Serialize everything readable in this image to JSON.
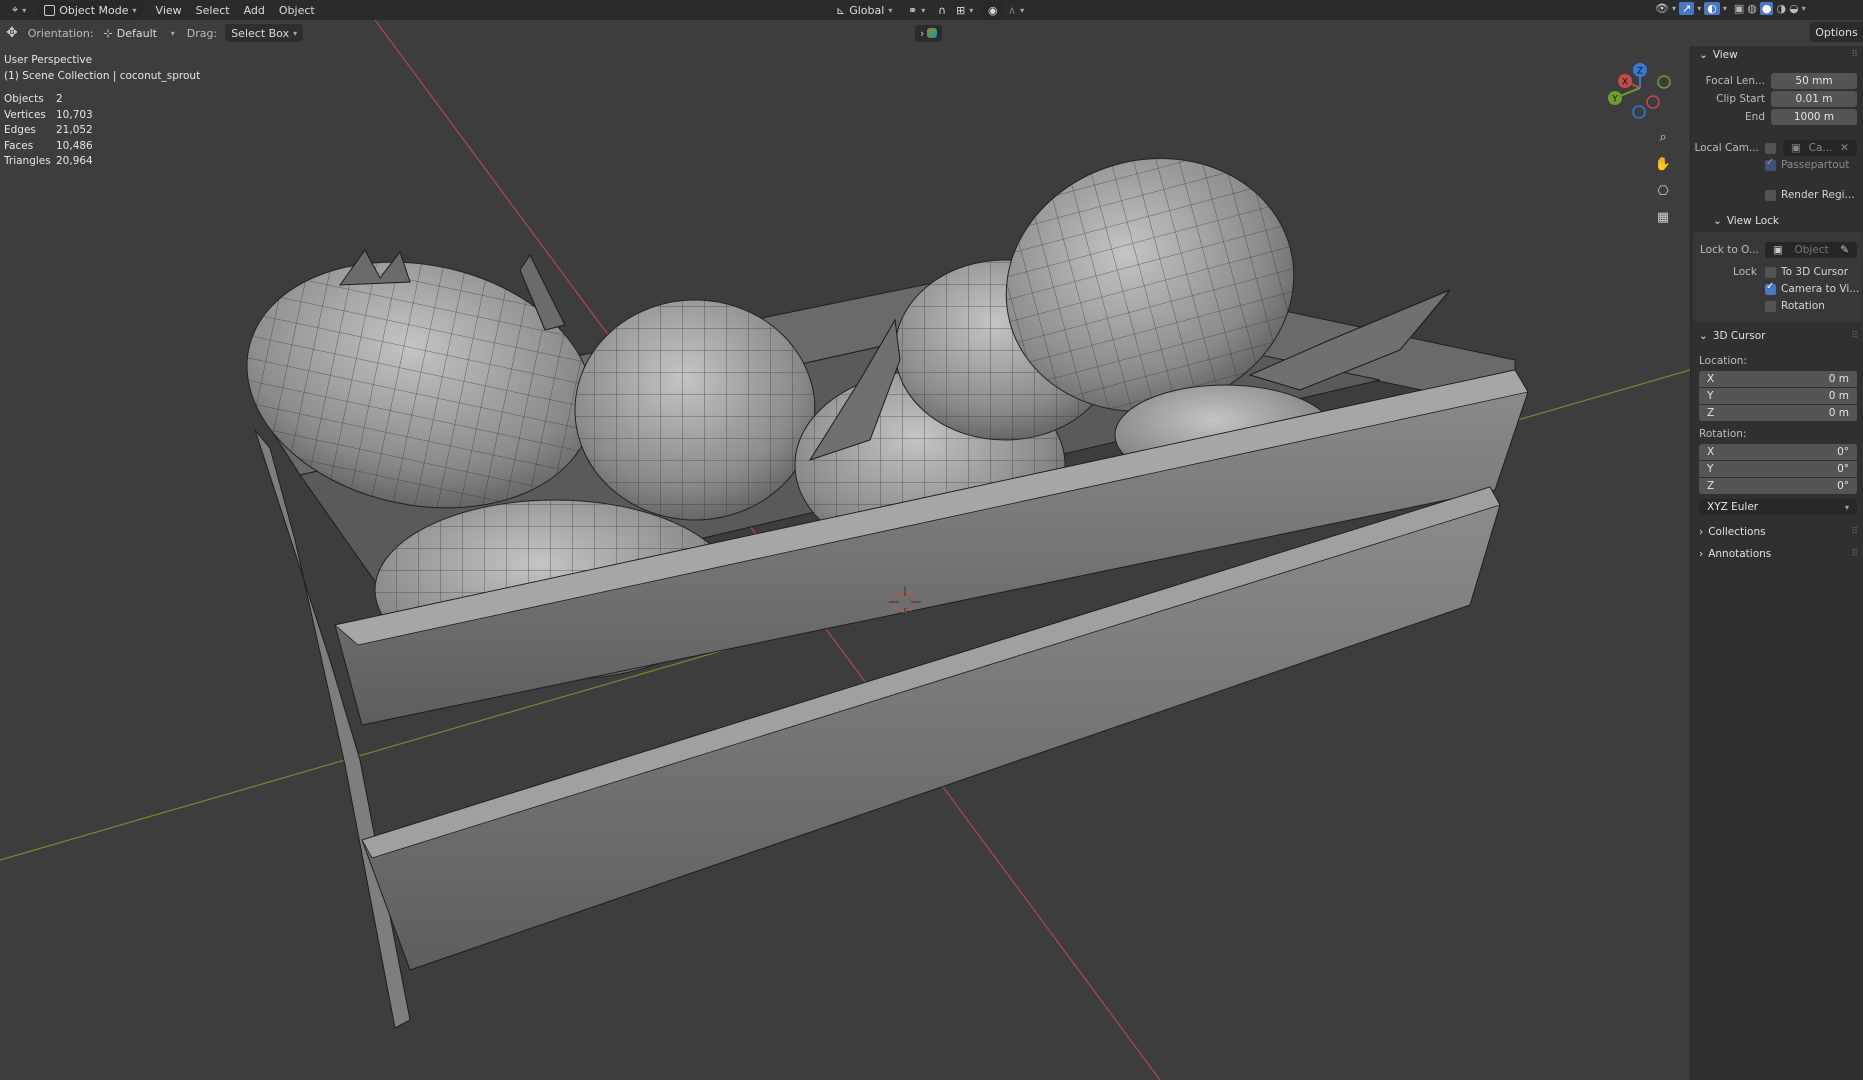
{
  "header": {
    "mode": "Object Mode",
    "menus": [
      "View",
      "Select",
      "Add",
      "Object"
    ],
    "transform_orientation": "Global"
  },
  "tool_settings": {
    "orientation_label": "Orientation:",
    "orientation_value": "Default",
    "drag_label": "Drag:",
    "drag_value": "Select Box",
    "options_label": "Options"
  },
  "viewport": {
    "perspective": "User Perspective",
    "collection": "(1) Scene Collection | coconut_sprout",
    "stats": [
      {
        "label": "Objects",
        "value": "2"
      },
      {
        "label": "Vertices",
        "value": "10,703"
      },
      {
        "label": "Edges",
        "value": "21,052"
      },
      {
        "label": "Faces",
        "value": "10,486"
      },
      {
        "label": "Triangles",
        "value": "20,964"
      }
    ],
    "gizmo_axes": [
      "X",
      "Y",
      "Z"
    ]
  },
  "npanel": {
    "view": {
      "title": "View",
      "focal_label": "Focal Len...",
      "focal_value": "50 mm",
      "clip_start_label": "Clip Start",
      "clip_start_value": "0.01 m",
      "end_label": "End",
      "end_value": "1000 m",
      "local_cam_label": "Local Cam...",
      "local_cam_value": "Ca...",
      "passepartout": "Passepartout",
      "render_region": "Render Regi..."
    },
    "view_lock": {
      "title": "View Lock",
      "lock_to_label": "Lock to O...",
      "lock_to_placeholder": "Object",
      "lock_label": "Lock",
      "to_3d_cursor": "To 3D Cursor",
      "camera_to_view": "Camera to Vi...",
      "rotation": "Rotation"
    },
    "cursor": {
      "title": "3D Cursor",
      "location_label": "Location:",
      "location": [
        {
          "axis": "X",
          "value": "0 m"
        },
        {
          "axis": "Y",
          "value": "0 m"
        },
        {
          "axis": "Z",
          "value": "0 m"
        }
      ],
      "rotation_label": "Rotation:",
      "rotation": [
        {
          "axis": "X",
          "value": "0°"
        },
        {
          "axis": "Y",
          "value": "0°"
        },
        {
          "axis": "Z",
          "value": "0°"
        }
      ],
      "rotation_mode": "XYZ Euler"
    },
    "collections": "Collections",
    "annotations": "Annotations"
  },
  "colors": {
    "background": "#3d3d3d",
    "x_axis": "#c24b4b",
    "y_axis": "#6e9e2e",
    "z_axis": "#3a78d8",
    "accent": "#4a77c4"
  }
}
